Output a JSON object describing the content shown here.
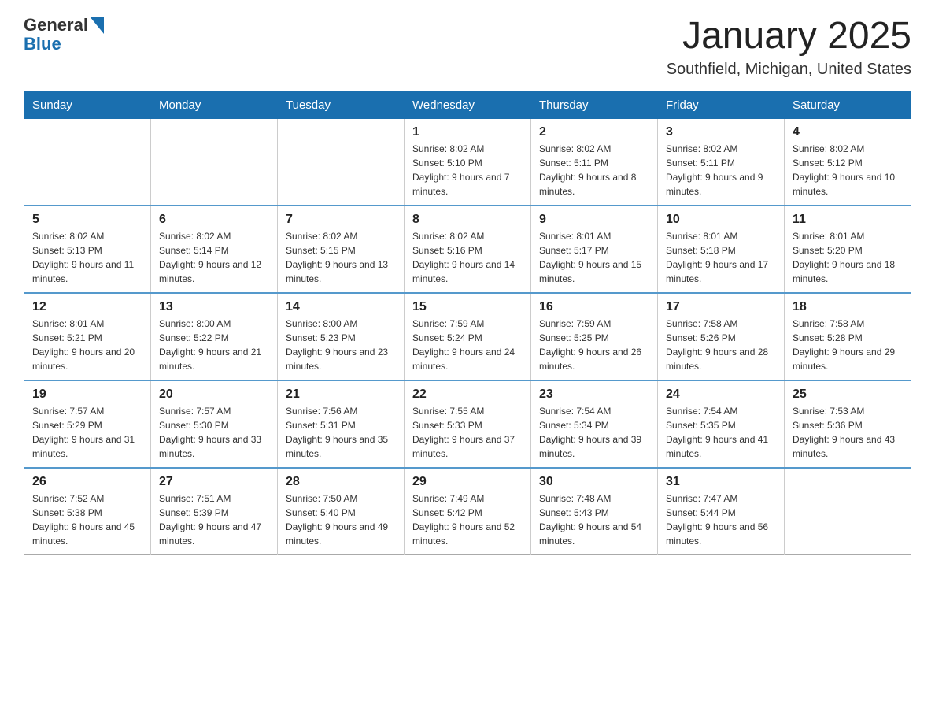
{
  "header": {
    "logo": {
      "text_general": "General",
      "text_blue": "Blue",
      "logo_label": "GeneralBlue logo"
    },
    "title": "January 2025",
    "subtitle": "Southfield, Michigan, United States"
  },
  "weekdays": [
    "Sunday",
    "Monday",
    "Tuesday",
    "Wednesday",
    "Thursday",
    "Friday",
    "Saturday"
  ],
  "weeks": [
    [
      {
        "day": "",
        "info": ""
      },
      {
        "day": "",
        "info": ""
      },
      {
        "day": "",
        "info": ""
      },
      {
        "day": "1",
        "info": "Sunrise: 8:02 AM\nSunset: 5:10 PM\nDaylight: 9 hours and 7 minutes."
      },
      {
        "day": "2",
        "info": "Sunrise: 8:02 AM\nSunset: 5:11 PM\nDaylight: 9 hours and 8 minutes."
      },
      {
        "day": "3",
        "info": "Sunrise: 8:02 AM\nSunset: 5:11 PM\nDaylight: 9 hours and 9 minutes."
      },
      {
        "day": "4",
        "info": "Sunrise: 8:02 AM\nSunset: 5:12 PM\nDaylight: 9 hours and 10 minutes."
      }
    ],
    [
      {
        "day": "5",
        "info": "Sunrise: 8:02 AM\nSunset: 5:13 PM\nDaylight: 9 hours and 11 minutes."
      },
      {
        "day": "6",
        "info": "Sunrise: 8:02 AM\nSunset: 5:14 PM\nDaylight: 9 hours and 12 minutes."
      },
      {
        "day": "7",
        "info": "Sunrise: 8:02 AM\nSunset: 5:15 PM\nDaylight: 9 hours and 13 minutes."
      },
      {
        "day": "8",
        "info": "Sunrise: 8:02 AM\nSunset: 5:16 PM\nDaylight: 9 hours and 14 minutes."
      },
      {
        "day": "9",
        "info": "Sunrise: 8:01 AM\nSunset: 5:17 PM\nDaylight: 9 hours and 15 minutes."
      },
      {
        "day": "10",
        "info": "Sunrise: 8:01 AM\nSunset: 5:18 PM\nDaylight: 9 hours and 17 minutes."
      },
      {
        "day": "11",
        "info": "Sunrise: 8:01 AM\nSunset: 5:20 PM\nDaylight: 9 hours and 18 minutes."
      }
    ],
    [
      {
        "day": "12",
        "info": "Sunrise: 8:01 AM\nSunset: 5:21 PM\nDaylight: 9 hours and 20 minutes."
      },
      {
        "day": "13",
        "info": "Sunrise: 8:00 AM\nSunset: 5:22 PM\nDaylight: 9 hours and 21 minutes."
      },
      {
        "day": "14",
        "info": "Sunrise: 8:00 AM\nSunset: 5:23 PM\nDaylight: 9 hours and 23 minutes."
      },
      {
        "day": "15",
        "info": "Sunrise: 7:59 AM\nSunset: 5:24 PM\nDaylight: 9 hours and 24 minutes."
      },
      {
        "day": "16",
        "info": "Sunrise: 7:59 AM\nSunset: 5:25 PM\nDaylight: 9 hours and 26 minutes."
      },
      {
        "day": "17",
        "info": "Sunrise: 7:58 AM\nSunset: 5:26 PM\nDaylight: 9 hours and 28 minutes."
      },
      {
        "day": "18",
        "info": "Sunrise: 7:58 AM\nSunset: 5:28 PM\nDaylight: 9 hours and 29 minutes."
      }
    ],
    [
      {
        "day": "19",
        "info": "Sunrise: 7:57 AM\nSunset: 5:29 PM\nDaylight: 9 hours and 31 minutes."
      },
      {
        "day": "20",
        "info": "Sunrise: 7:57 AM\nSunset: 5:30 PM\nDaylight: 9 hours and 33 minutes."
      },
      {
        "day": "21",
        "info": "Sunrise: 7:56 AM\nSunset: 5:31 PM\nDaylight: 9 hours and 35 minutes."
      },
      {
        "day": "22",
        "info": "Sunrise: 7:55 AM\nSunset: 5:33 PM\nDaylight: 9 hours and 37 minutes."
      },
      {
        "day": "23",
        "info": "Sunrise: 7:54 AM\nSunset: 5:34 PM\nDaylight: 9 hours and 39 minutes."
      },
      {
        "day": "24",
        "info": "Sunrise: 7:54 AM\nSunset: 5:35 PM\nDaylight: 9 hours and 41 minutes."
      },
      {
        "day": "25",
        "info": "Sunrise: 7:53 AM\nSunset: 5:36 PM\nDaylight: 9 hours and 43 minutes."
      }
    ],
    [
      {
        "day": "26",
        "info": "Sunrise: 7:52 AM\nSunset: 5:38 PM\nDaylight: 9 hours and 45 minutes."
      },
      {
        "day": "27",
        "info": "Sunrise: 7:51 AM\nSunset: 5:39 PM\nDaylight: 9 hours and 47 minutes."
      },
      {
        "day": "28",
        "info": "Sunrise: 7:50 AM\nSunset: 5:40 PM\nDaylight: 9 hours and 49 minutes."
      },
      {
        "day": "29",
        "info": "Sunrise: 7:49 AM\nSunset: 5:42 PM\nDaylight: 9 hours and 52 minutes."
      },
      {
        "day": "30",
        "info": "Sunrise: 7:48 AM\nSunset: 5:43 PM\nDaylight: 9 hours and 54 minutes."
      },
      {
        "day": "31",
        "info": "Sunrise: 7:47 AM\nSunset: 5:44 PM\nDaylight: 9 hours and 56 minutes."
      },
      {
        "day": "",
        "info": ""
      }
    ]
  ]
}
